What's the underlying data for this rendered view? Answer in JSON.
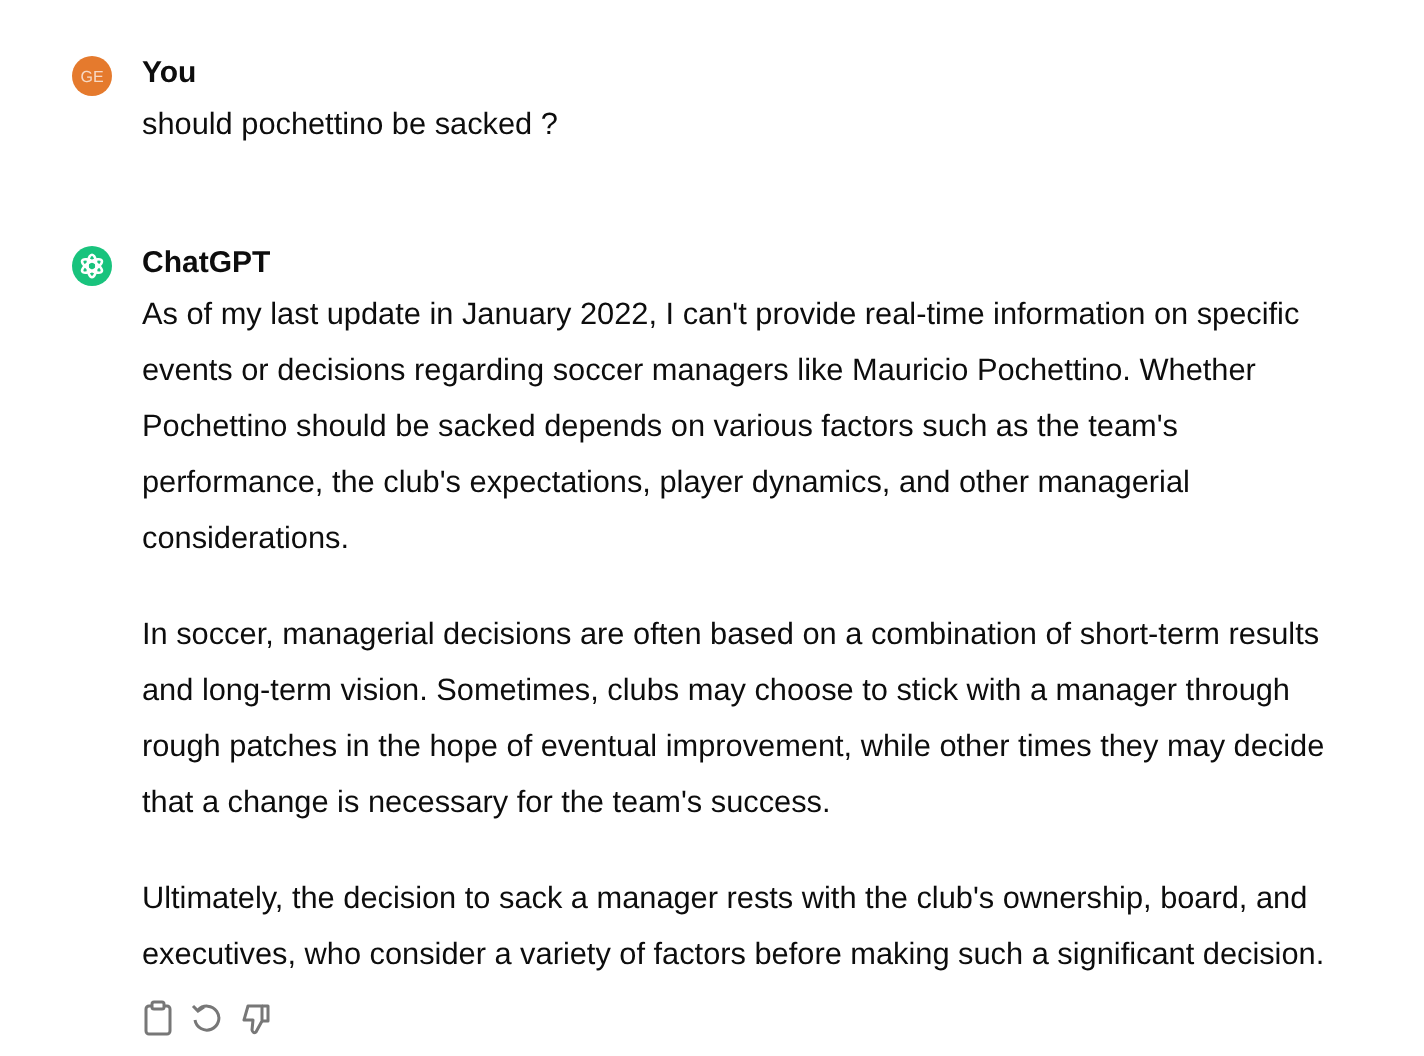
{
  "messages": [
    {
      "kind": "user",
      "avatar": "GE",
      "author": "You",
      "paragraphs": [
        "should pochettino be sacked ?"
      ]
    },
    {
      "kind": "assistant",
      "author": "ChatGPT",
      "paragraphs": [
        "As of my last update in January 2022, I can't provide real-time information on specific events or decisions regarding soccer managers like Mauricio Pochettino. Whether Pochettino should be sacked depends on various factors such as the team's performance, the club's expectations, player dynamics, and other managerial considerations.",
        "In soccer, managerial decisions are often based on a combination of short-term results and long-term vision. Sometimes, clubs may choose to stick with a manager through rough patches in the hope of eventual improvement, while other times they may decide that a change is necessary for the team's success.",
        "Ultimately, the decision to sack a manager rests with the club's ownership, board, and executives, who consider a variety of factors before making such a significant decision."
      ],
      "actions": [
        {
          "kind": "copy"
        },
        {
          "kind": "regenerate"
        },
        {
          "kind": "thumbs-down"
        }
      ]
    }
  ]
}
